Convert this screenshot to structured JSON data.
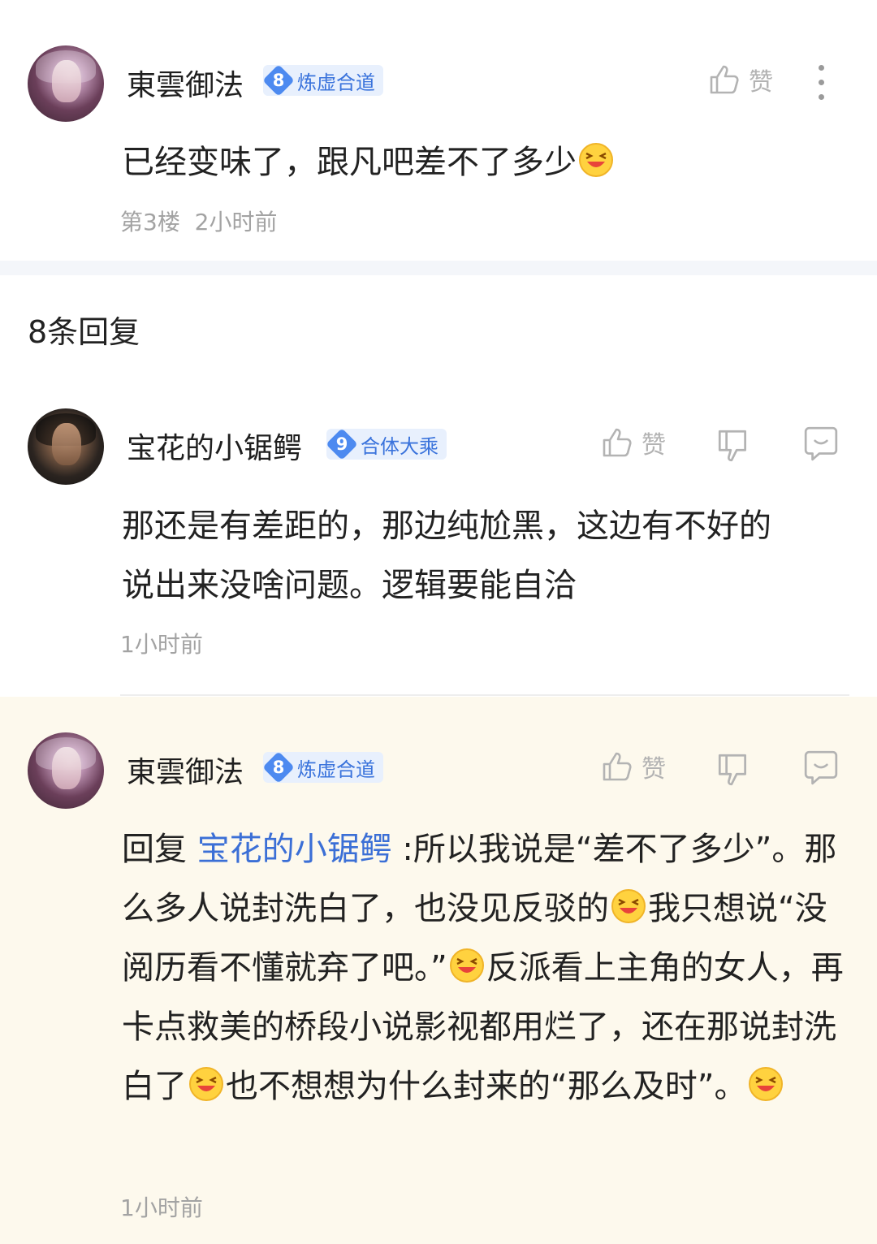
{
  "main_comment": {
    "username": "東雲御法",
    "badge_level": "8",
    "badge_title": "炼虚合道",
    "like_label": "赞",
    "text": "已经变味了，跟凡吧差不了多少",
    "floor": "第3楼",
    "time": "2小时前"
  },
  "replies_header": "8条回复",
  "replies": [
    {
      "username": "宝花的小锯鳄",
      "badge_level": "9",
      "badge_title": "合体大乘",
      "like_label": "赞",
      "text_line1": "那还是有差距的，那边纯尬黑，这边有不好的",
      "text_line2": "说出来没啥问题。逻辑要能自洽",
      "time": "1小时前"
    },
    {
      "username": "東雲御法",
      "badge_level": "8",
      "badge_title": "炼虚合道",
      "like_label": "赞",
      "reply_prefix": "回复 ",
      "mention": "宝花的小锯鳄",
      "seg1": " :所以我说是“差不了多少”。那么多人说封洗白了，也没见反驳的",
      "seg2": "我只想说“没阅历看不懂就弃了吧。”",
      "seg3": "反派看上主角的女人，再卡点救美的桥段小说影视都用烂了，还在那说封洗白了",
      "seg4": "也不想想为什么封来的“那么及时”。",
      "time": "1小时前"
    }
  ],
  "colors": {
    "accent": "#3b6fd6",
    "badge_bg": "#e8f0fd",
    "highlight_bg": "#fdf9ed",
    "meta_gray": "#a3a3a3"
  },
  "icons": [
    "thumbs-up-icon",
    "thumbs-down-icon",
    "reply-bubble-icon",
    "more-vertical-icon",
    "laughing-emoji-icon"
  ]
}
